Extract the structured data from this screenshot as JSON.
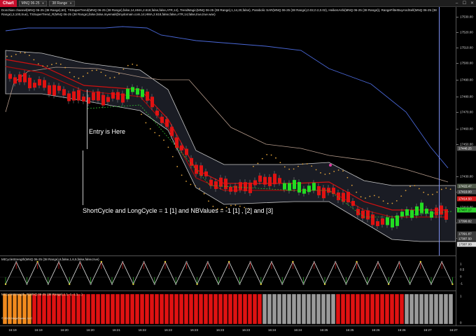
{
  "app": {
    "tab": "Chart",
    "instrument": "MNQ 06-25",
    "interval": "38 Range",
    "controls": [
      "–",
      "☐",
      "✕"
    ]
  },
  "indicator_text": "Donchian channel(MNQ 06-25 (38 Range),50), TSSuperTrend(MNQ 06-25 (38 Range),false,14,HMA,2.618,false,false,ATR,14), TrendMagic(MNQ 06-25 (38 Range),1,14,20,false), Parabolic SAR(MNQ 06-25 (38 Range),0.02,0.2,0.02), HeikenAshi(MNQ 06-25 (38 Range)), RangeFilterBuyAndSell(MNQ 06-25 (38 Range),3,100,true), TSSuperTrend_R(MNQ 06-25 (38 Range),false,false,myemail@mydomain.com,14,HMA,2.618,false,false,ATR,14,false,true,true.wav)",
  "annotations": {
    "entry": "Entry is Here",
    "cycle": "ShortCycle and LongCycle = 1 [1] and NBValues = -1 [1] , [2] and [3]"
  },
  "price_axis": {
    "labels": [
      "17530.00",
      "17520.00",
      "17510.00",
      "17500.00",
      "17490.00",
      "17480.00",
      "17470.00",
      "17460.00",
      "17450.00",
      "17430.00",
      "17420.00",
      "17410.00",
      "17400.00",
      "17390.00"
    ],
    "boxes": [
      {
        "text": "17446.25",
        "bg": "#4d4d4d",
        "fg": "#ffffff"
      },
      {
        "text": "17422.47",
        "bg": "#505a4a",
        "fg": "#ffffff"
      },
      {
        "text": "17419.00",
        "bg": "#4a4a4a",
        "fg": "#ffffff"
      },
      {
        "text": "17414.50",
        "bg": "#d41d1d",
        "fg": "#ffffff"
      },
      {
        "text": "17407.17",
        "bg": "#2fd32f",
        "fg": "#000000"
      },
      {
        "text": "17399.82",
        "bg": "#3a3a3a",
        "fg": "#ffffff"
      },
      {
        "text": "17391.87",
        "bg": "#3a3a3a",
        "fg": "#ffffff"
      },
      {
        "text": "17387.50",
        "bg": "#3a3a3a",
        "fg": "#ffffff"
      },
      {
        "text": "17387.00",
        "bg": "#dcdcdc",
        "fg": "#000000"
      }
    ]
  },
  "oscillator": {
    "title": "MtCycleStrength(MNQ 06-25 (38 Range),6,false,1,6,5,false,false,true)",
    "axis": [
      "1",
      "0.5",
      "0",
      "-1"
    ]
  },
  "bar_panel": {
    "title": "MtCycleStrength_R(MNQ 06-25 (38 Range),1,1,-1,-1,1,...)",
    "copyright": "© 2025 NinjaTrader, LLC",
    "axis": [
      "1",
      "0"
    ]
  },
  "time_axis": [
    "16:19",
    "16:19",
    "16:20",
    "16:20",
    "16:21",
    "16:22",
    "16:22",
    "16:23",
    "16:23",
    "16:23",
    "16:24",
    "16:24",
    "16:25",
    "16:25",
    "16:26",
    "16:26",
    "16:27",
    "16:27"
  ],
  "colors": {
    "bull": "#22dd22",
    "bear": "#e01212",
    "channel": "#c9c9c9",
    "donchian": "#4a68d8",
    "sar": "#e0a33c",
    "cursor": "#7d8ff0"
  }
}
